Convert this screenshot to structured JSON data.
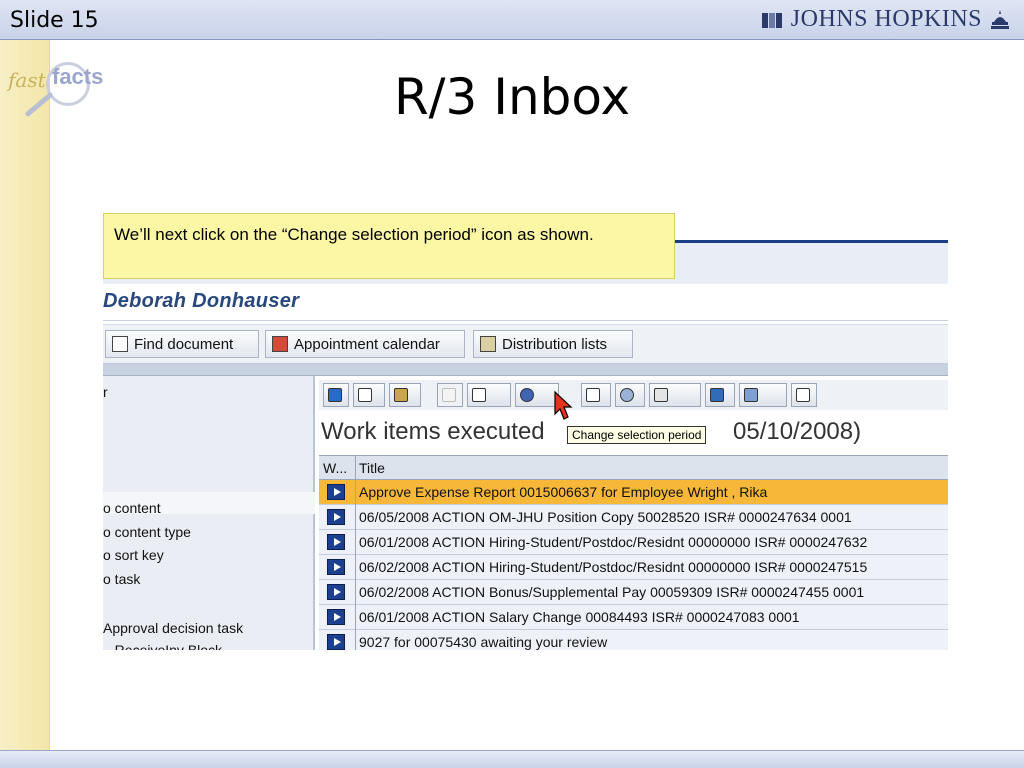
{
  "slide": {
    "number_label": "Slide 15",
    "brand": "JOHNS HOPKINS",
    "logo_fast": "fast",
    "logo_facts": "facts",
    "title": "R/3 Inbox",
    "callout": "We’ll next click on the “Change selection period” icon as shown."
  },
  "sap": {
    "user_name": "Deborah Donhauser",
    "buttons": [
      {
        "label": "Find document",
        "icon": "binoculars-icon"
      },
      {
        "label": "Appointment calendar",
        "icon": "calendar-icon"
      },
      {
        "label": "Distribution lists",
        "icon": "distribution-list-icon"
      }
    ],
    "left_panel": {
      "top_fragment": "r",
      "items": [
        "o content",
        "o content type",
        "o sort key",
        "o task"
      ],
      "bottom_item": "Approval decision task",
      "cut_item": "...ReceiveInv Block"
    },
    "workitems_title": "Work items executed",
    "workitems_date": "05/10/2008)",
    "tooltip": "Change selection period",
    "grid_headers": {
      "w": "W...",
      "title": "Title"
    },
    "rows": [
      {
        "title": "Approve Expense Report 0015006637 for Employee Wright , Rika",
        "highlight": true
      },
      {
        "title": "06/05/2008 ACTION OM-JHU Position Copy 50028520 ISR# 0000247634 0001",
        "highlight": false
      },
      {
        "title": "06/01/2008 ACTION Hiring-Student/Postdoc/Residnt 00000000 ISR# 0000247632",
        "highlight": false
      },
      {
        "title": "06/02/2008 ACTION Hiring-Student/Postdoc/Residnt 00000000 ISR# 0000247515",
        "highlight": false
      },
      {
        "title": "06/02/2008 ACTION Bonus/Supplemental Pay 00059309 ISR# 0000247455 0001",
        "highlight": false
      },
      {
        "title": "06/01/2008 ACTION Salary Change 00084493 ISR# 0000247083 0001",
        "highlight": false
      },
      {
        "title": "9027 for 00075430 awaiting your review",
        "highlight": false
      }
    ],
    "colors": {
      "highlight_row": "#f7b83a",
      "row_bg": "#eef2f8",
      "header_bg": "#dde3ec",
      "accent": "#1b3e86"
    }
  }
}
